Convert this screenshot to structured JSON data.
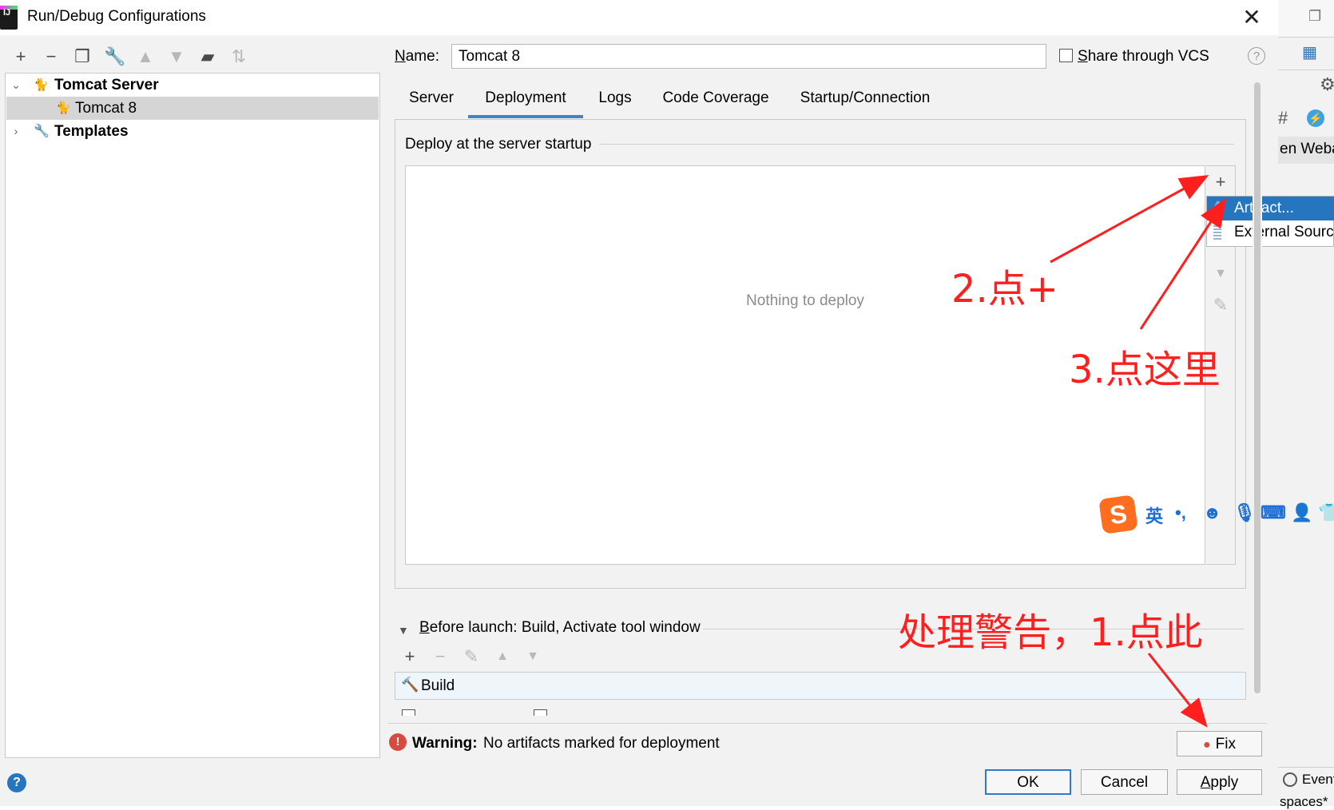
{
  "window": {
    "title": "Run/Debug Configurations",
    "close_glyph": "✕"
  },
  "toolbar": {
    "icons": [
      "add-icon",
      "remove-icon",
      "copy-icon",
      "wrench-icon",
      "move-up-icon",
      "move-down-icon",
      "folder-add-icon",
      "sort-icon"
    ]
  },
  "tree": {
    "group": "Tomcat Server",
    "item": "Tomcat 8",
    "templates": "Templates"
  },
  "name_field": {
    "label_underlined": "N",
    "label_rest": "ame:",
    "value": "Tomcat 8"
  },
  "share": {
    "label_underlined": "S",
    "label_rest": "hare through VCS",
    "help": "?"
  },
  "tabs": [
    {
      "label": "Server"
    },
    {
      "label": "Deployment",
      "active": true
    },
    {
      "label": "Logs"
    },
    {
      "label": "Code Coverage"
    },
    {
      "label": "Startup/Connection"
    }
  ],
  "deployment": {
    "section_title": "Deploy at the server startup",
    "empty_text": "Nothing to deploy",
    "popup": [
      {
        "label": "Artifact...",
        "selected": true
      },
      {
        "label": "External Source"
      }
    ]
  },
  "before_launch": {
    "title_underlined": "B",
    "title_rest": "efore launch: Build, Activate tool window",
    "build_label": "Build"
  },
  "warning": {
    "prefix": "Warning:",
    "message": "No artifacts marked for deployment",
    "fix_label": "Fix"
  },
  "buttons": {
    "ok": "OK",
    "cancel": "Cancel",
    "apply_underlined": "A",
    "apply_rest": "pply"
  },
  "ide_right": {
    "tool_label": "en Weba",
    "event_label": "Event",
    "spaces_label": "spaces*"
  },
  "annotations": {
    "step2": "2.点+",
    "step3": "3.点这里",
    "step1": "处理警告，1.点此",
    "color": "#ff1f1f"
  },
  "ime": {
    "lang": "英",
    "punct": "•,"
  },
  "colors": {
    "accent": "#4083c9",
    "selection": "#2675bf",
    "warning": "#d84a3f"
  }
}
